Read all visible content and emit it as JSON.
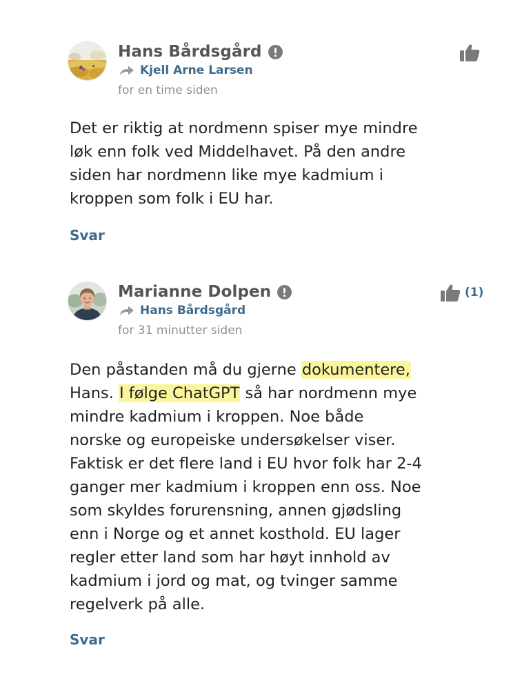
{
  "comments": [
    {
      "author": "Hans Bårdsgård",
      "reply_to": "Kjell Arne Larsen",
      "timestamp": "for en time siden",
      "likes": "",
      "body_lines": [
        "Det er riktig at nordmenn spiser mye mindre",
        "løk enn folk ved Middelhavet. På den andre",
        "siden har nordmenn like mye kadmium i",
        "kroppen som folk i EU har."
      ],
      "reply_label": "Svar",
      "avatar_icon": "avatar-landscape"
    },
    {
      "author": "Marianne Dolpen",
      "reply_to": "Hans Bårdsgård",
      "timestamp": "for 31 minutter siden",
      "likes": "(1)",
      "body": {
        "l1_pre": "Den påstanden må du gjerne ",
        "l1_hl": "dokumentere,",
        "l2_pre": "Hans. ",
        "l2_hl": "I følge ChatGPT",
        "l2_post": " så har nordmenn mye",
        "l3": "mindre kadmium i kroppen. Noe både",
        "l4": "norske og europeiske undersøkelser viser.",
        "l5": "Faktisk er det flere land i EU hvor folk har 2-4",
        "l6": "ganger mer kadmium i kroppen enn oss. Noe",
        "l7": "som skyldes forurensning, annen gjødsling",
        "l8": "enn i Norge og et annet kosthold. EU lager",
        "l9": "regler etter land som har høyt innhold av",
        "l10": "kadmium i jord og mat, og tvinger samme",
        "l11": "regelverk på alle."
      },
      "reply_label": "Svar",
      "avatar_icon": "avatar-person"
    }
  ],
  "colors": {
    "author": "#555555",
    "link": "#3d6b8c",
    "timestamp": "#8f8f8f",
    "highlight": "#fbf69b",
    "icon_gray": "#7a7a7a"
  },
  "icons": {
    "info": "info-icon",
    "reply_arrow": "reply-arrow-icon",
    "like": "thumbs-up-icon"
  }
}
